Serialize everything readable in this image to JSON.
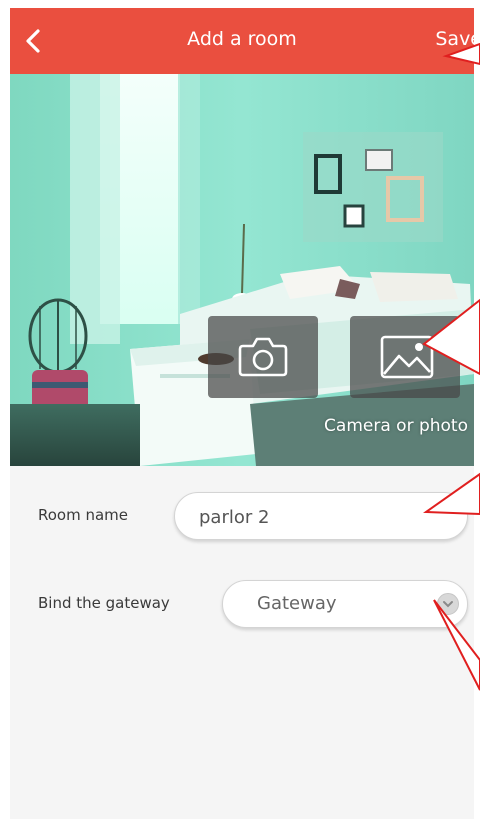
{
  "header": {
    "title": "Add a room",
    "save_label": "Save",
    "background_color": "#ea4f3f"
  },
  "photo": {
    "caption": "Camera or photo",
    "camera_icon": "camera-icon",
    "gallery_icon": "image-icon"
  },
  "form": {
    "room_name_label": "Room name",
    "room_name_value": "parlor 2",
    "gateway_label": "Bind the gateway",
    "gateway_value": "Gateway",
    "gateway_dropdown_icon": "chevron-down-icon"
  },
  "annotation_color": "#e01f1f"
}
